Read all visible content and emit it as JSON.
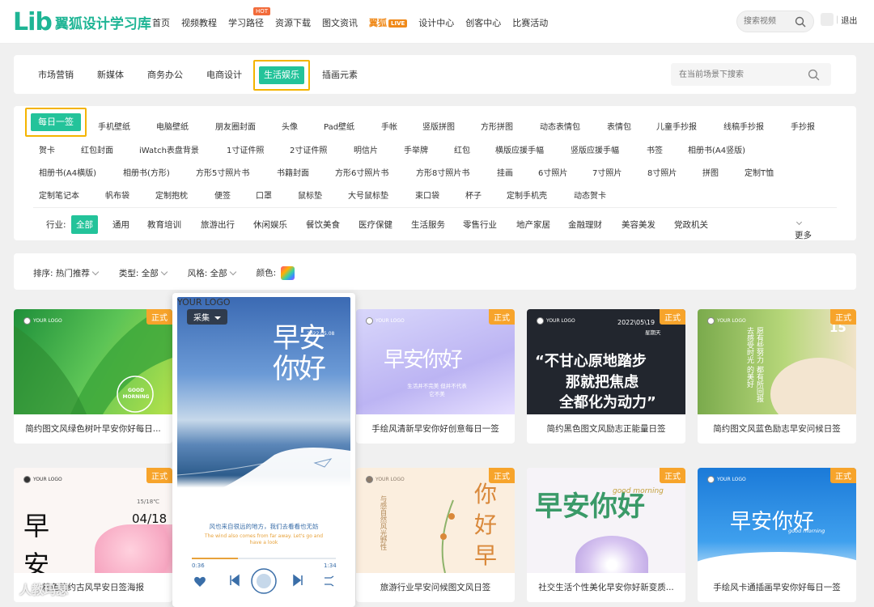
{
  "logo": {
    "mark": "Lib",
    "name": "翼狐设计学习库"
  },
  "nav": {
    "items": [
      "首页",
      "视频教程",
      "学习路径",
      "资源下载",
      "图文资讯",
      "翼狐",
      "设计中心",
      "创客中心",
      "比赛活动"
    ],
    "hot_badge": "HOT",
    "live_badge": "LIVE"
  },
  "search": {
    "placeholder": "搜索视频"
  },
  "user": {
    "logout": "退出"
  },
  "scenes": {
    "items": [
      "市场营销",
      "新媒体",
      "商务办公",
      "电商设计",
      "插画元素"
    ],
    "active": "生活娱乐",
    "search_placeholder": "在当前场景下搜索"
  },
  "tags": {
    "active": "每日一签",
    "row1": [
      "手机壁纸",
      "电脑壁纸",
      "朋友圈封面",
      "头像",
      "Pad壁纸",
      "手帐",
      "竖版拼图",
      "方形拼图",
      "动态表情包",
      "表情包",
      "儿童手抄报",
      "线稿手抄报",
      "手抄报"
    ],
    "row2": [
      "贺卡",
      "红包封面",
      "iWatch表盘背景",
      "1寸证件照",
      "2寸证件照",
      "明信片",
      "手举牌",
      "红包",
      "横版应援手幅",
      "竖版应援手幅",
      "书签",
      "相册书(A4竖版)"
    ],
    "row3": [
      "相册书(A4横版)",
      "相册书(方形)",
      "方形5寸照片书",
      "书籍封面",
      "方形6寸照片书",
      "方形8寸照片书",
      "挂画",
      "6寸照片",
      "7寸照片",
      "8寸照片",
      "拼图",
      "定制T恤"
    ],
    "row4": [
      "定制笔记本",
      "帆布袋",
      "定制抱枕",
      "便签",
      "口罩",
      "鼠标垫",
      "大号鼠标垫",
      "束口袋",
      "杯子",
      "定制手机壳",
      "动态贺卡"
    ]
  },
  "industry": {
    "label": "行业:",
    "active": "全部",
    "items": [
      "通用",
      "教育培训",
      "旅游出行",
      "休闲娱乐",
      "餐饮美食",
      "医疗保健",
      "生活服务",
      "零售行业",
      "地产家居",
      "金融理财",
      "美容美发",
      "党政机关"
    ],
    "more": "更多"
  },
  "filters": {
    "sort_label": "排序:",
    "sort_value": "热门推荐",
    "type_label": "类型:",
    "type_value": "全部",
    "style_label": "风格:",
    "style_value": "全部",
    "color_label": "颜色:"
  },
  "cards": [
    {
      "title": "简约图文风绿色树叶早安你好每日...",
      "badge": "正式",
      "img_text": "GOOD MORNING"
    },
    {
      "title": "手绘风清新早安你好创意每日一签",
      "badge": "正式",
      "img_text": "早安你好",
      "img_sub": "生活并不完美 但并不代表它不美"
    },
    {
      "title": "简约黑色图文风励志正能量日签",
      "badge": "正式",
      "img_date": "2022\\05\\19",
      "img_week": "星期天",
      "img_l1": "“不甘心原地踏步",
      "img_l2": "那就把焦虑",
      "img_l3": "全都化为动力”"
    },
    {
      "title": "简约图文风蓝色励志早安问候日签",
      "badge": "正式",
      "img_num": "15",
      "img_poem": "愿有些努力 都有所回报 去感受时光 的美好"
    },
    {
      "title": "粉色简约古风早安日签海报",
      "badge": "正式",
      "img_big": "早安",
      "img_temp": "15/18℃",
      "img_date": "04/18"
    },
    {
      "title": "旅游行业早安问候图文风日签",
      "badge": "正式",
      "img_big": "你好早",
      "img_side": "与感自然风光野性"
    },
    {
      "title": "社交生活个性美化早安你好新变质...",
      "badge": "正式",
      "img_big": "早安你好",
      "img_en": "good morning"
    },
    {
      "title": "手绘风卡通插画早安你好每日一签",
      "badge": "正式",
      "img_big": "早安你好",
      "img_en": "good morning"
    }
  ],
  "big_card": {
    "collect": "采集",
    "big_text": "早安你好",
    "date": "2022.05.08",
    "caption": "风也来自很远的地方，我们去看看也无妨",
    "caption_en": "The wind also comes from far away. Let's go and have a look",
    "t_start": "0:36",
    "t_end": "1:34",
    "progress": 0.32
  },
  "logo_small": "YOUR LOGO",
  "watermark": "人教玛瑟",
  "colors": {
    "accent": "#23c39a",
    "highlight": "#f4b400",
    "badge": "#f7a42b"
  }
}
